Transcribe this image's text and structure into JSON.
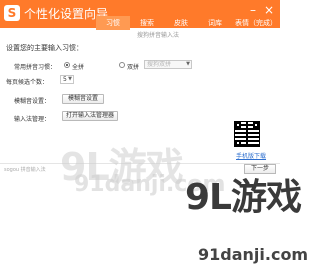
{
  "window": {
    "title": "个性化设置向导",
    "subtitle": "搜狗拼音输入法"
  },
  "tabs": [
    {
      "label": "习惯",
      "active": true
    },
    {
      "label": "搜索",
      "active": false
    },
    {
      "label": "皮肤",
      "active": false
    },
    {
      "label": "词库",
      "active": false
    },
    {
      "label": "表情（完成）",
      "active": false
    }
  ],
  "content": {
    "section_title": "设置您的主要输入习惯：",
    "pinyin_habit": {
      "label": "常用拼音习惯：",
      "options": [
        {
          "label": "全拼",
          "selected": true
        },
        {
          "label": "双拼",
          "selected": false
        }
      ],
      "shuangpin_scheme": "搜狗双拼"
    },
    "candidates": {
      "label": "每页候选个数：",
      "value": "5"
    },
    "fuzzy": {
      "label": "模糊音设置：",
      "button": "模糊音设置"
    },
    "ime_manage": {
      "label": "输入法管理：",
      "button": "打开输入法管理器"
    }
  },
  "side": {
    "mobile_download": "手机版下载"
  },
  "footer": {
    "left_text": "sogou 拼音输入法",
    "next_button": "下一步"
  },
  "watermark": {
    "text_big": "9L游戏",
    "text_small": "91danji.com",
    "color": "#3a3a3a"
  },
  "colors": {
    "accent": "#ff7a2a",
    "tab_active": "#ff9a52",
    "link": "#2d6fcf"
  }
}
